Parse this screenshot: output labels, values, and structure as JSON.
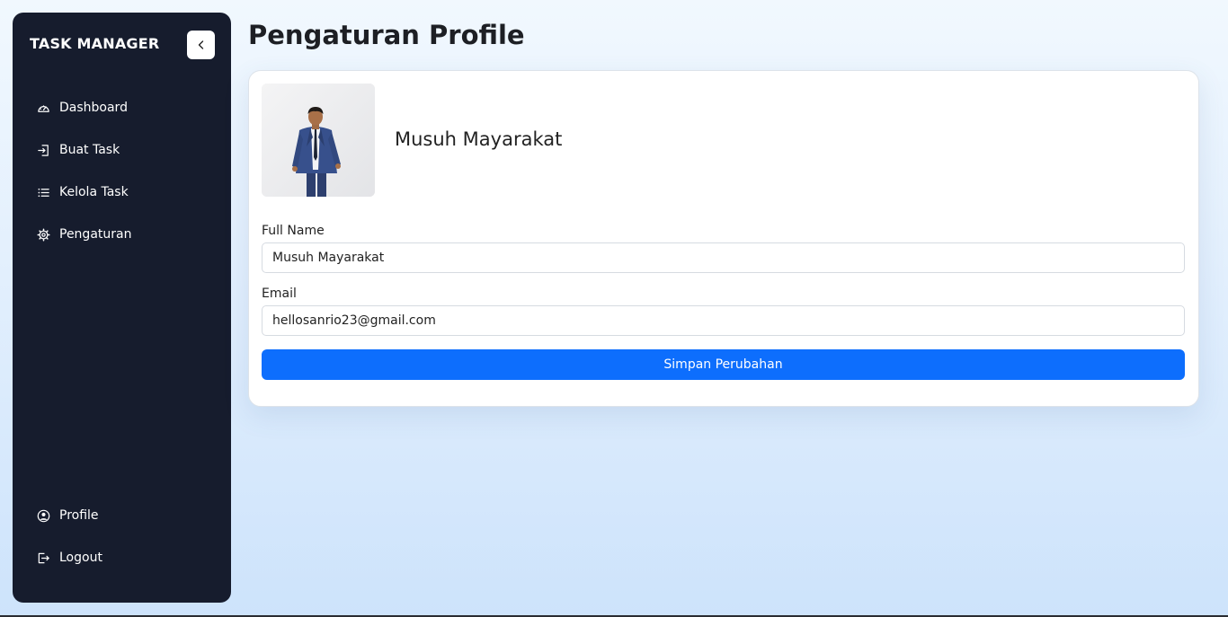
{
  "app": {
    "brand": "TASK MANAGER"
  },
  "sidebar": {
    "items": [
      {
        "label": "Dashboard",
        "icon": "speedometer-icon"
      },
      {
        "label": "Buat Task",
        "icon": "box-arrow-in-icon"
      },
      {
        "label": "Kelola Task",
        "icon": "list-icon"
      },
      {
        "label": "Pengaturan",
        "icon": "gear-icon"
      }
    ],
    "bottom_items": [
      {
        "label": "Profile",
        "icon": "person-circle-icon"
      },
      {
        "label": "Logout",
        "icon": "logout-icon"
      }
    ],
    "collapse_icon": "chevron-left-icon"
  },
  "main": {
    "title": "Pengaturan Profile",
    "profile": {
      "display_name": "Musuh Mayarakat"
    },
    "form": {
      "full_name_label": "Full Name",
      "full_name_value": "Musuh Mayarakat",
      "email_label": "Email",
      "email_value": "hellosanrio23@gmail.com",
      "save_label": "Simpan Perubahan"
    }
  },
  "colors": {
    "sidebar_bg": "#161c2d",
    "accent": "#0d6efd"
  }
}
